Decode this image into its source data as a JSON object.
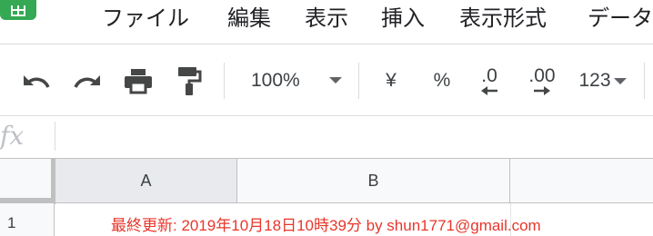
{
  "menu": {
    "items": [
      "ファイル",
      "編集",
      "表示",
      "挿入",
      "表示形式",
      "データ"
    ]
  },
  "toolbar": {
    "zoom": "100%",
    "currency_symbol": "¥",
    "percent_symbol": "%",
    "decrease_decimals": ".0",
    "increase_decimals": ".00",
    "more_formats": "123"
  },
  "formula_bar": {
    "icon_text": "fx",
    "value": ""
  },
  "grid": {
    "columns": [
      "A",
      "B"
    ],
    "rows": [
      {
        "number": "1",
        "text": "最終更新: 2019年10月18日10時39分 by shun1771@gmail.com",
        "text_color": "#e8362b"
      }
    ]
  },
  "colors": {
    "brand": "#34a853",
    "selected_header": "#e8eaed",
    "header_bg": "#f8f9fa"
  }
}
